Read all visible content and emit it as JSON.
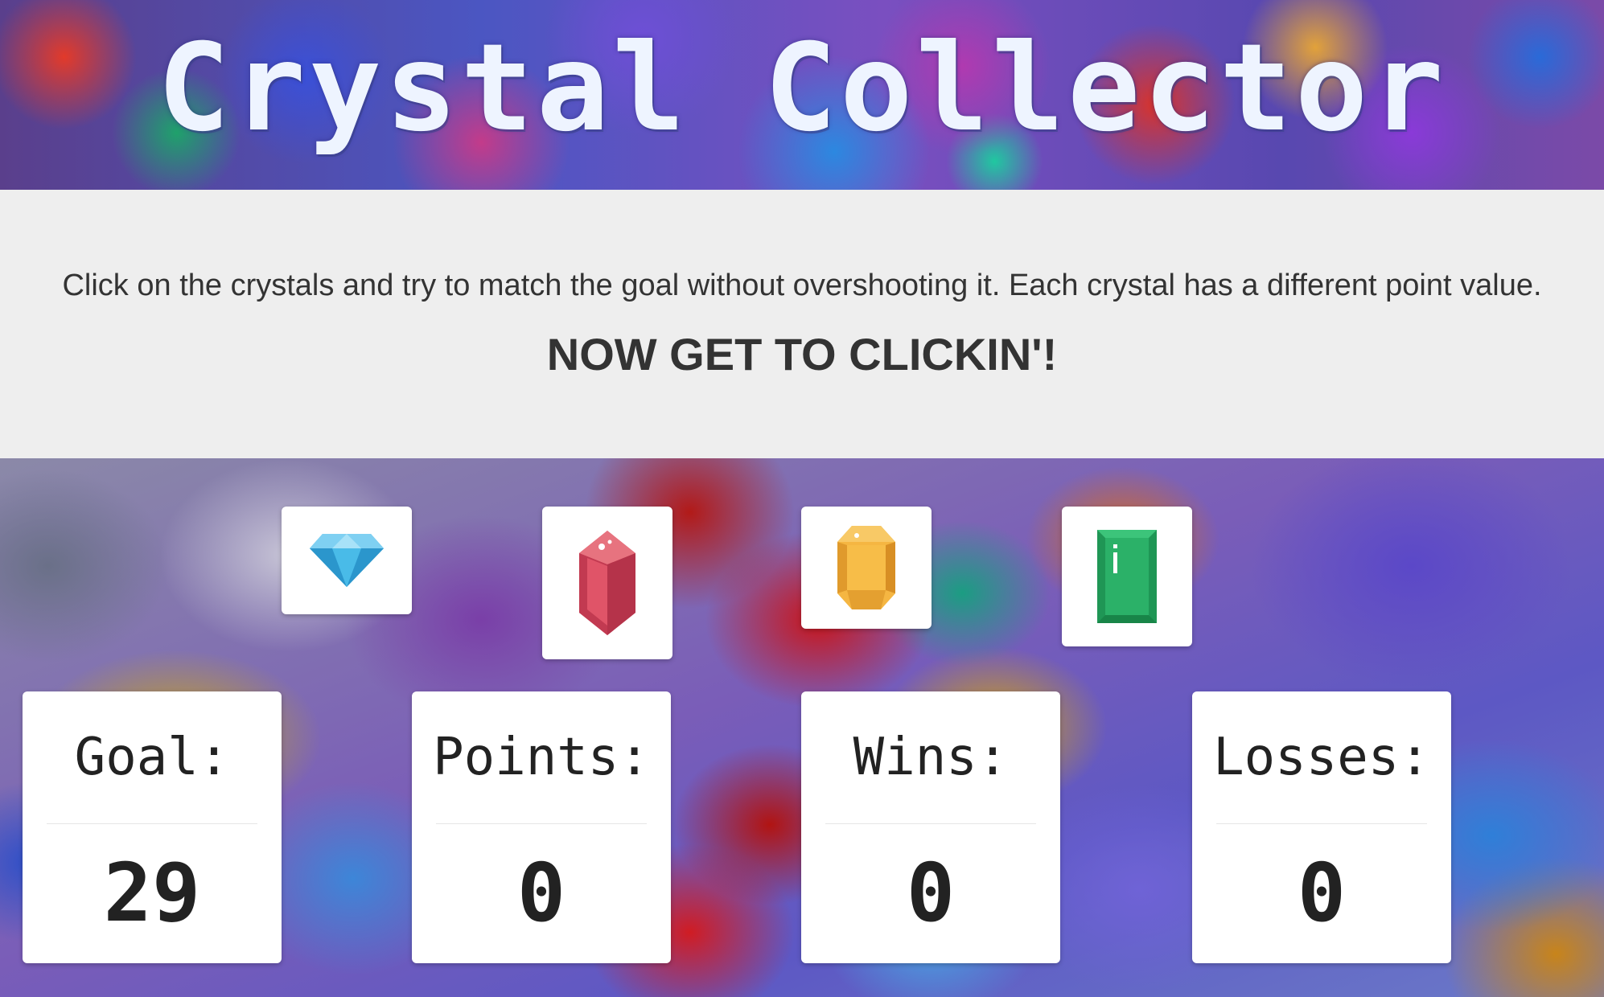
{
  "header": {
    "title": "Crystal Collector"
  },
  "intro": {
    "instructions": "Click on the crystals and try to match the goal without overshooting it. Each crystal has a different point value.",
    "call_to_action": "NOW GET TO CLICKIN'!"
  },
  "crystals": [
    {
      "name": "blue diamond",
      "icon": "blue-diamond-icon",
      "color": "#3aaee0"
    },
    {
      "name": "red gem",
      "icon": "red-gem-icon",
      "color": "#d9485f"
    },
    {
      "name": "yellow gem",
      "icon": "yellow-gem-icon",
      "color": "#f5b642"
    },
    {
      "name": "green gem",
      "icon": "green-gem-icon",
      "color": "#2aa866"
    }
  ],
  "stats": {
    "goal": {
      "label": "Goal:",
      "value": "29"
    },
    "points": {
      "label": "Points:",
      "value": "0"
    },
    "wins": {
      "label": "Wins:",
      "value": "0"
    },
    "losses": {
      "label": "Losses:",
      "value": "0"
    }
  }
}
